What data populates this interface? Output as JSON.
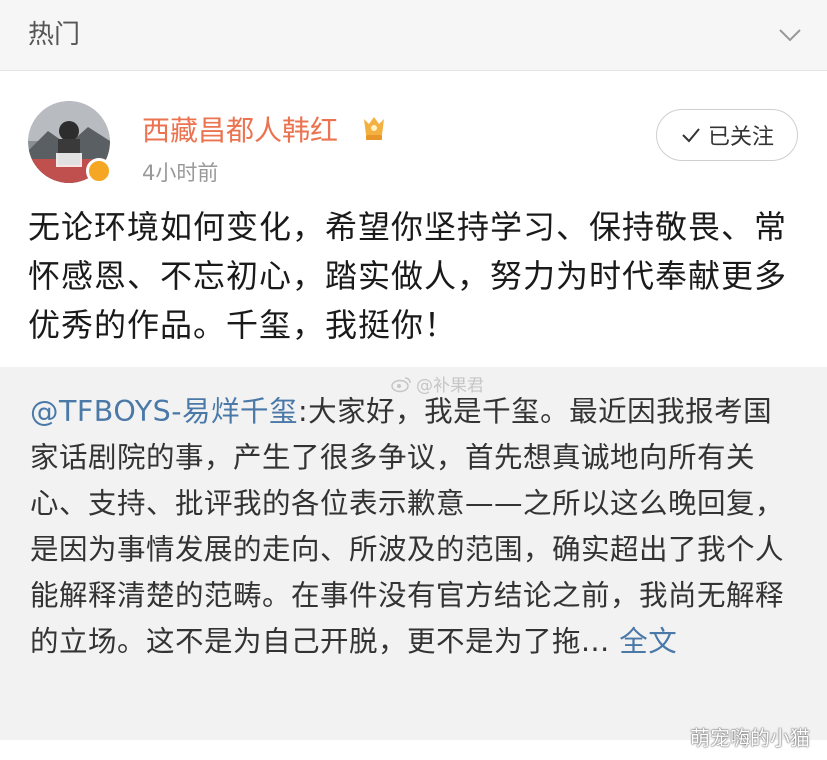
{
  "header": {
    "title": "热门",
    "chevron_icon": "chevron-down-icon"
  },
  "post": {
    "username": "西藏昌都人韩红",
    "time": "4小时前",
    "follow_label": "已关注",
    "text": "无论环境如何变化，希望你坚持学习、保持敬畏、常怀感恩、不忘初心，踏实做人，努力为时代奉献更多优秀的作品。千玺，我挺你！",
    "username_color": "#eb7350"
  },
  "repost": {
    "mention": "@TFBOYS-易烊千玺",
    "body": ":大家好，我是千玺。最近因我报考国家话剧院的事，产生了很多争议，首先想真诚地向所有关心、支持、批评我的各位表示歉意——之所以这么晚回复，是因为事情发展的走向、所波及的范围，确实超出了我个人能解释清楚的范畴。在事件没有官方结论之前，我尚无解释的立场。这不是为自己开脱，更不是为了拖... ",
    "fulltext_label": "全文",
    "link_color": "#4a79a8"
  },
  "watermarks": {
    "center": "@补果君",
    "corner": "萌宠嗨的小猫"
  }
}
